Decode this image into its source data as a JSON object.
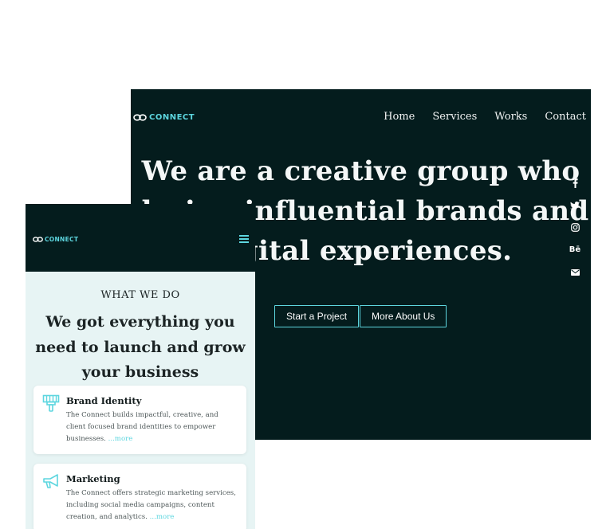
{
  "desktop": {
    "brand": "CONNECT",
    "nav": [
      "Home",
      "Services",
      "Works",
      "Contact"
    ],
    "hero_lines": [
      "We are a creative group who",
      "design influential brands and",
      "digital experiences."
    ],
    "buttons": {
      "primary": "Start a Project",
      "secondary": "More About Us"
    },
    "social_icons": [
      "facebook-icon",
      "twitter-icon",
      "instagram-icon",
      "behance-icon",
      "email-icon"
    ],
    "social_glyphs": {
      "behance": "Bē"
    }
  },
  "mobile": {
    "brand": "CONNECT",
    "kicker": "WHAT WE DO",
    "heading": "We got everything you need to launch and grow your business",
    "services": [
      {
        "title": "Brand Identity",
        "text": "The Connect builds impactful, creative, and client focused brand identities to empower businesses.",
        "more": "...more",
        "icon": "paint-brush-icon"
      },
      {
        "title": "Marketing",
        "text": "The Connect offers strategic marketing services, including social media campaigns, content creation, and analytics.",
        "more": "...more",
        "icon": "megaphone-icon"
      }
    ]
  },
  "colors": {
    "dark_bg": "#041c1d",
    "accent": "#5dd6df",
    "light_bg": "#e7f4f4"
  }
}
